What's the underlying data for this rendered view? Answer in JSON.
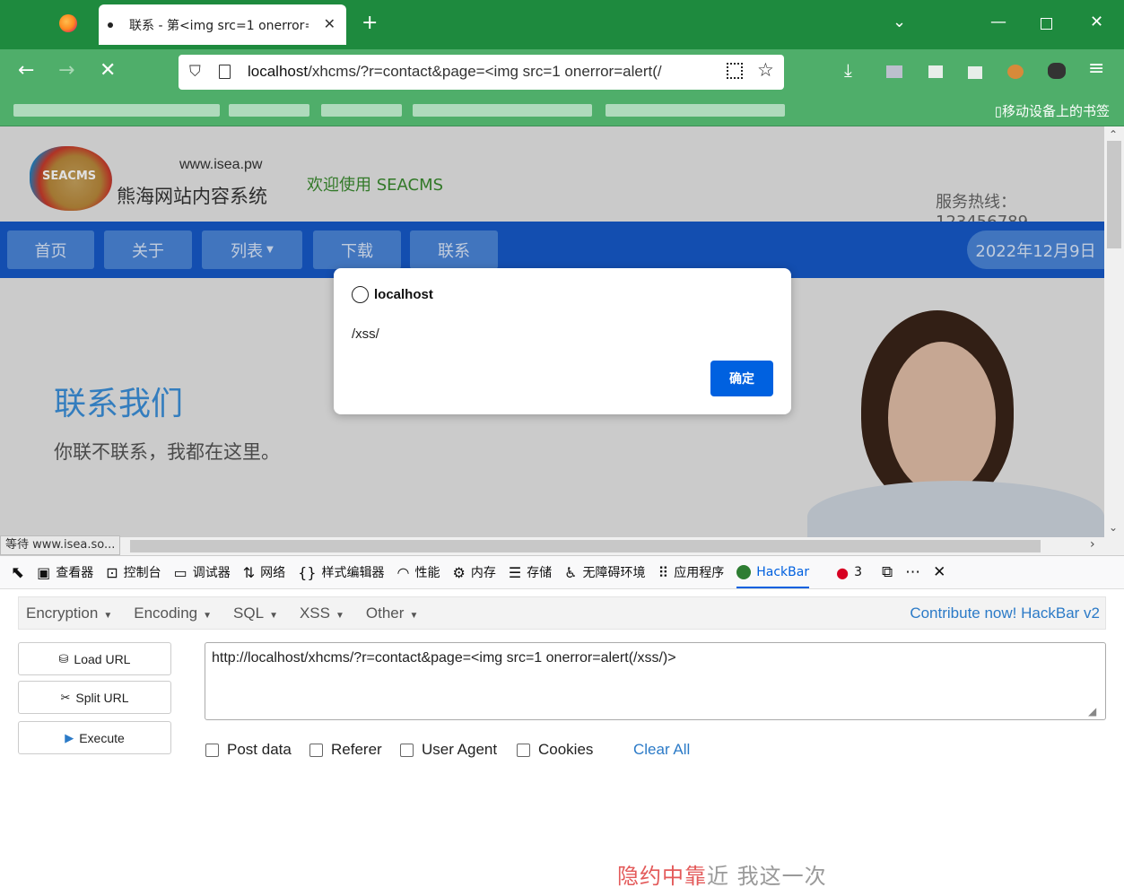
{
  "browser": {
    "tab_title": "联系 - 第<img src=1 onerror=",
    "url_host": "localhost",
    "url_rest": "/xhcms/?r=contact&page=<img src=1 onerror=alert(/",
    "mobile_bookmarks": "移动设备上的书签"
  },
  "site": {
    "domain": "www.isea.pw",
    "name": "熊海网站内容系统",
    "logo_text": "SEACMS",
    "welcome": "欢迎使用 SEACMS",
    "hotline": "服务热线：123456789",
    "nav": [
      "首页",
      "关于",
      "列表",
      "下载",
      "联系"
    ],
    "date": "2022年12月9日",
    "hero_title": "联系我们",
    "hero_subtitle": "你联不联系，我都在这里。"
  },
  "status": "等待 www.isea.so...",
  "dialog": {
    "origin": "localhost",
    "message": "/xss/",
    "ok_label": "确定"
  },
  "devtools": {
    "tabs": [
      "查看器",
      "控制台",
      "调试器",
      "网络",
      "样式编辑器",
      "性能",
      "内存",
      "存储",
      "无障碍环境",
      "应用程序",
      "HackBar"
    ],
    "error_count": "3"
  },
  "hackbar": {
    "menus": [
      "Encryption",
      "Encoding",
      "SQL",
      "XSS",
      "Other"
    ],
    "contribute": "Contribute now!",
    "version": "HackBar v2",
    "load_url": "Load URL",
    "split_url": "Split URL",
    "execute": "Execute",
    "url_value": "http://localhost/xhcms/?r=contact&page=<img src=1 onerror=alert(/xss/)>",
    "options": [
      "Post data",
      "Referer",
      "User Agent",
      "Cookies"
    ],
    "clear_all": "Clear All"
  },
  "watermark": {
    "red": "隐约中靠",
    "gray": "近 我这一次"
  },
  "colors": {
    "titlebar": "#1e8a3e",
    "navbar": "#4fae6a",
    "site_nav": "#1659c9",
    "dialog_button": "#0061e0",
    "link": "#2b7ac7"
  }
}
